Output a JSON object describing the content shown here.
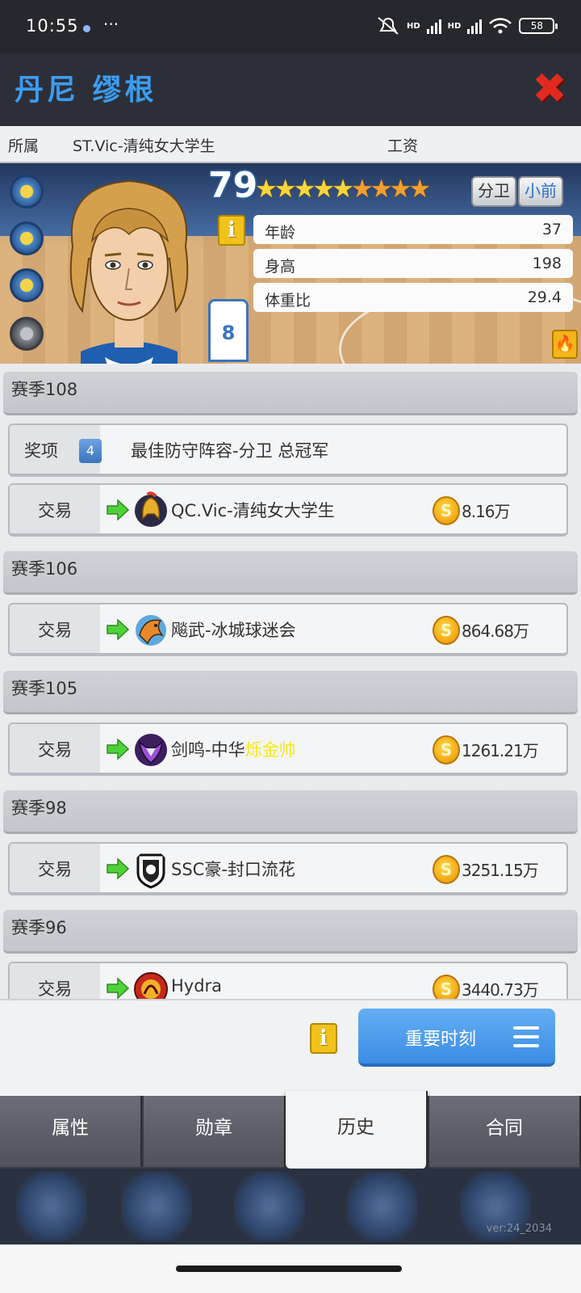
{
  "status_bar": {
    "time": "10:55",
    "more": "···",
    "signal1_label": "HD",
    "signal2_label": "HD",
    "battery": "58"
  },
  "header": {
    "title": "丹尼 缪根"
  },
  "info_row": {
    "team_label": "所属",
    "team_value": "ST.Vic-清纯女大学生",
    "salary_label": "工资"
  },
  "player": {
    "rating": "79",
    "stars_total": 9,
    "stars_gold": 5,
    "positions": [
      "分卫",
      "小前"
    ],
    "jersey_number": "8",
    "stats": [
      {
        "label": "年龄",
        "value": "37"
      },
      {
        "label": "身高",
        "value": "198"
      },
      {
        "label": "体重比",
        "value": "29.4"
      }
    ]
  },
  "history": {
    "seasons": [
      {
        "label": "赛季108",
        "entries": [
          {
            "type": "奖项",
            "count": "4",
            "text": "最佳防守阵容-分卫 总冠军"
          },
          {
            "type": "交易",
            "team_pre": "QC.Vic-清纯女大学生",
            "team_hl": "",
            "money": "8.16万",
            "logo": "spartan-helmet-logo"
          }
        ]
      },
      {
        "label": "赛季106",
        "entries": [
          {
            "type": "交易",
            "team_pre": "飚武-冰城球迷会",
            "team_hl": "",
            "money": "864.68万",
            "logo": "dragon-logo"
          }
        ]
      },
      {
        "label": "赛季105",
        "entries": [
          {
            "type": "交易",
            "team_pre": "剑鸣-中华",
            "team_hl": "烁金帅",
            "money": "1261.21万",
            "logo": "purple-bird-logo"
          }
        ]
      },
      {
        "label": "赛季98",
        "entries": [
          {
            "type": "交易",
            "team_pre": "SSC豪-封口流花",
            "team_hl": "",
            "money": "3251.15万",
            "logo": "lion-shield-logo"
          }
        ]
      },
      {
        "label": "赛季96",
        "entries": [
          {
            "type": "交易",
            "team_pre": "Hydra",
            "team_hl": "",
            "money": "3440.73万",
            "logo": "hydra-logo"
          }
        ]
      }
    ]
  },
  "actions": {
    "info_icon": "i",
    "moments_label": "重要时刻"
  },
  "tabs": [
    {
      "label": "属性",
      "active": false
    },
    {
      "label": "勋章",
      "active": false
    },
    {
      "label": "历史",
      "active": true
    },
    {
      "label": "合同",
      "active": false
    }
  ],
  "footer": {
    "version": "ver:24_2034"
  },
  "colors": {
    "accent_blue": "#3b9cf0",
    "close_red": "#e02a20",
    "highlight_yellow": "#f2ea18",
    "coin_gold": "#f2a612"
  }
}
